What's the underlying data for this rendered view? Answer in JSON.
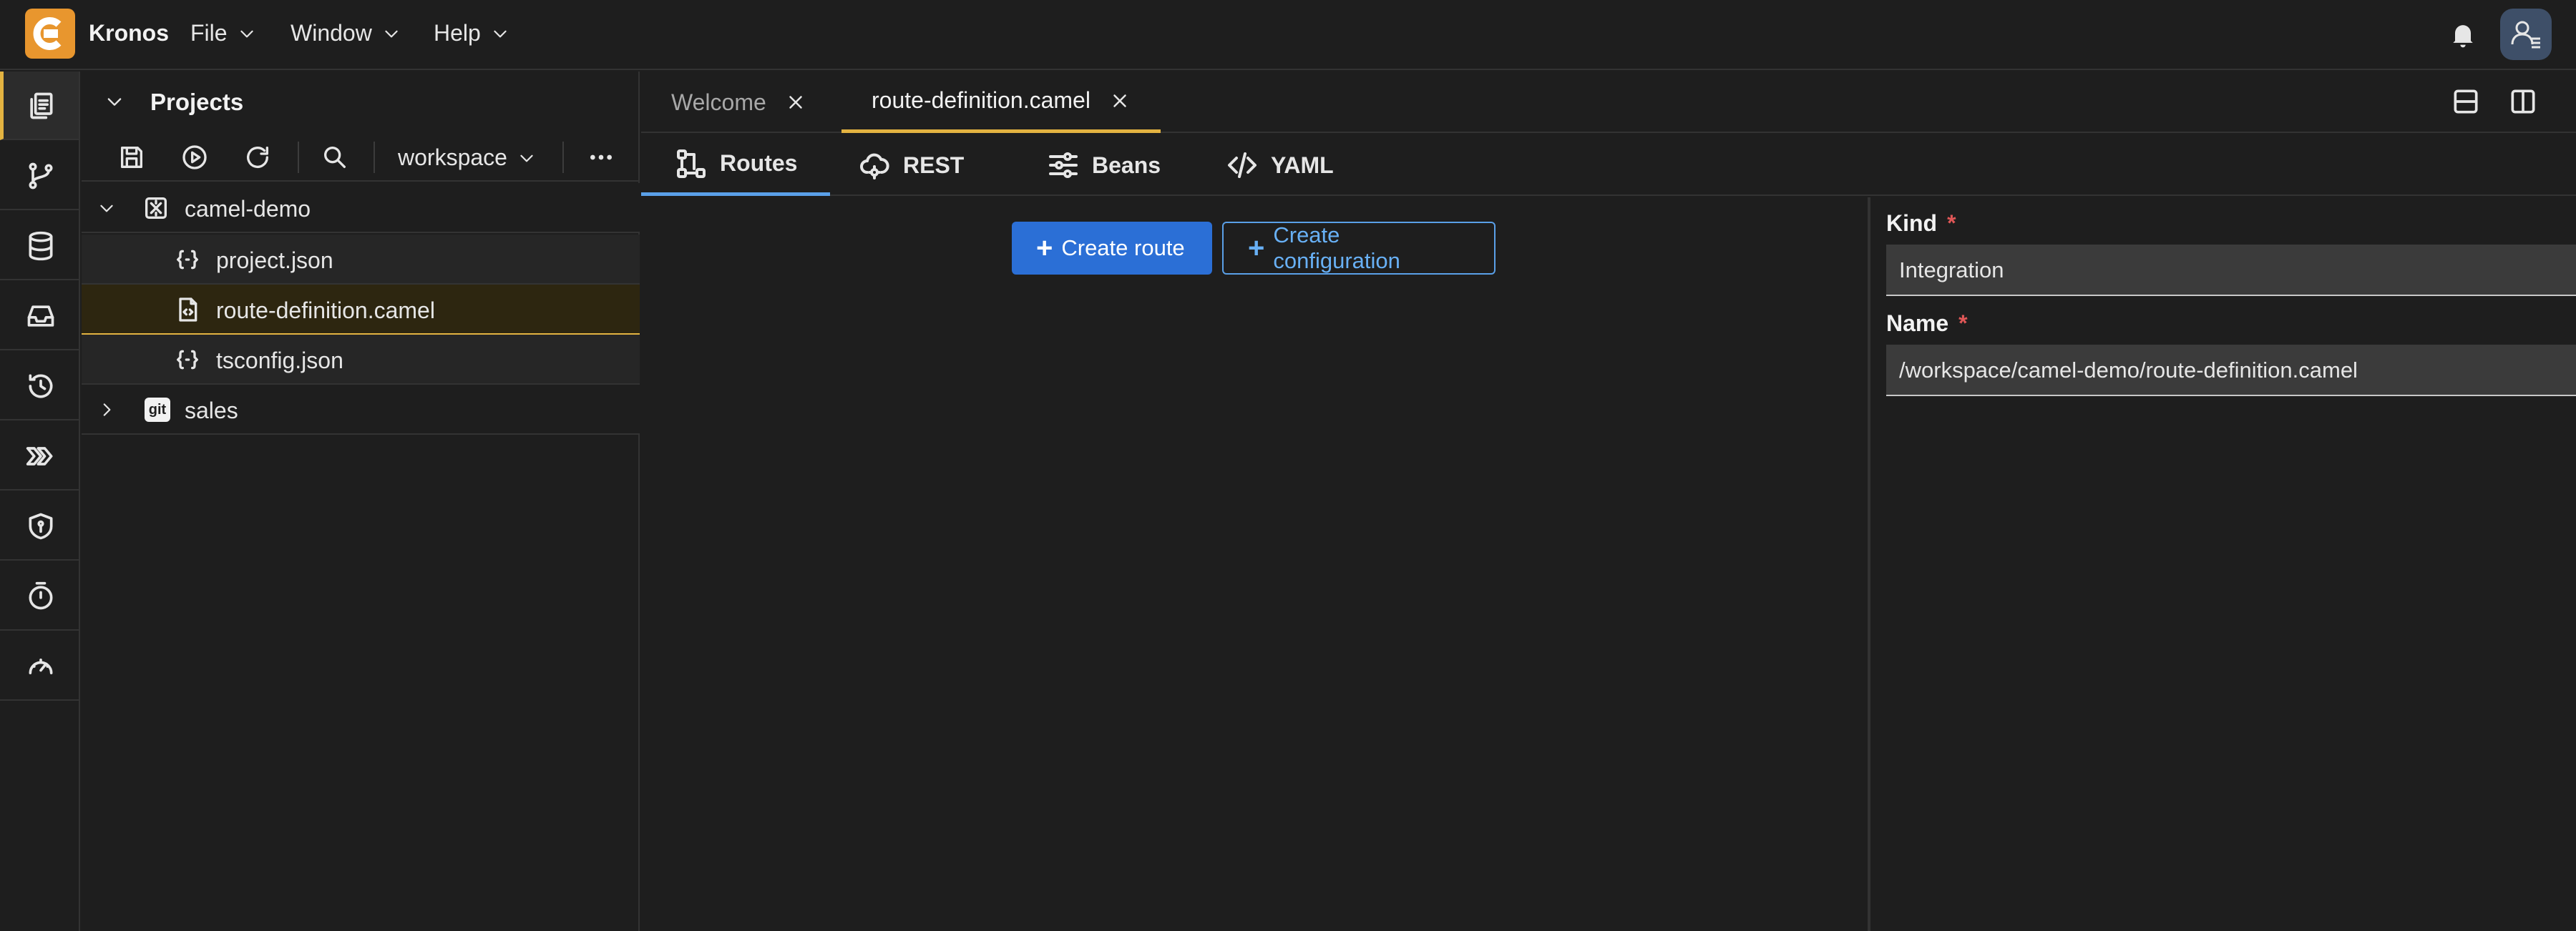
{
  "app": {
    "title": "Kronos"
  },
  "menubar": {
    "items": [
      {
        "label": "File"
      },
      {
        "label": "Window"
      },
      {
        "label": "Help"
      }
    ]
  },
  "activity_bar": {
    "items": [
      {
        "icon": "copy-icon",
        "active": true
      },
      {
        "icon": "git-branch-icon"
      },
      {
        "icon": "database-icon"
      },
      {
        "icon": "inbox-icon"
      },
      {
        "icon": "history-icon"
      },
      {
        "icon": "chevrons-right-icon"
      },
      {
        "icon": "shield-icon"
      },
      {
        "icon": "alarm-icon"
      },
      {
        "icon": "gauge-icon"
      }
    ]
  },
  "sidebar": {
    "title": "Projects",
    "workspace": "workspace",
    "tree": [
      {
        "label": "camel-demo",
        "expanded": true,
        "icon": "project-icon"
      },
      {
        "label": "project.json",
        "icon": "json-file-icon"
      },
      {
        "label": "route-definition.camel",
        "icon": "camel-file-icon",
        "selected": true
      },
      {
        "label": "tsconfig.json",
        "icon": "json-file-icon"
      },
      {
        "label": "sales",
        "expanded": false,
        "icon": "git-icon",
        "badge": "git"
      }
    ]
  },
  "editor": {
    "tabs": [
      {
        "label": "Welcome",
        "active": false
      },
      {
        "label": "route-definition.camel",
        "active": true
      }
    ],
    "subtabs": [
      {
        "label": "Routes",
        "active": true
      },
      {
        "label": "REST"
      },
      {
        "label": "Beans"
      },
      {
        "label": "YAML"
      }
    ],
    "buttons": {
      "create_route": "Create route",
      "create_configuration": "Create configuration"
    }
  },
  "properties": {
    "kind": {
      "label": "Kind",
      "value": "Integration"
    },
    "name": {
      "label": "Name",
      "value": "/workspace/camel-demo/route-definition.camel"
    },
    "required_mark": "*"
  },
  "colors": {
    "accent": "#e3b341",
    "primary_button": "#2b6fd6",
    "link_blue": "#5aa0e8",
    "logo": "#e8962e",
    "background": "#1e1e1e"
  }
}
